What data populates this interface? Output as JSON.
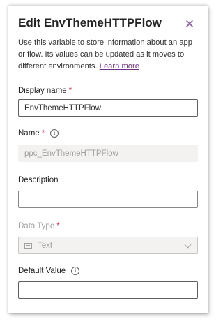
{
  "panel": {
    "title": "Edit EnvThemeHTTPFlow",
    "close_symbol": "✕",
    "description": "Use this variable to store information about an app or flow. Its values can be updated as it moves to different environments.",
    "learn_more": "Learn more"
  },
  "fields": {
    "display_name": {
      "label": "Display name",
      "required": "*",
      "value": "EnvThemeHTTPFlow"
    },
    "name": {
      "label": "Name",
      "required": "*",
      "info": "i",
      "value": "ppc_EnvThemeHTTPFlow"
    },
    "description": {
      "label": "Description",
      "value": ""
    },
    "data_type": {
      "label": "Data Type",
      "required": "*",
      "value": "Text",
      "icon": "text-type-icon"
    },
    "default_value": {
      "label": "Default Value",
      "info": "i",
      "value": ""
    }
  },
  "colors": {
    "accent": "#6e2f8a",
    "required": "#c4314b",
    "disabled_text": "#a19f9d"
  }
}
